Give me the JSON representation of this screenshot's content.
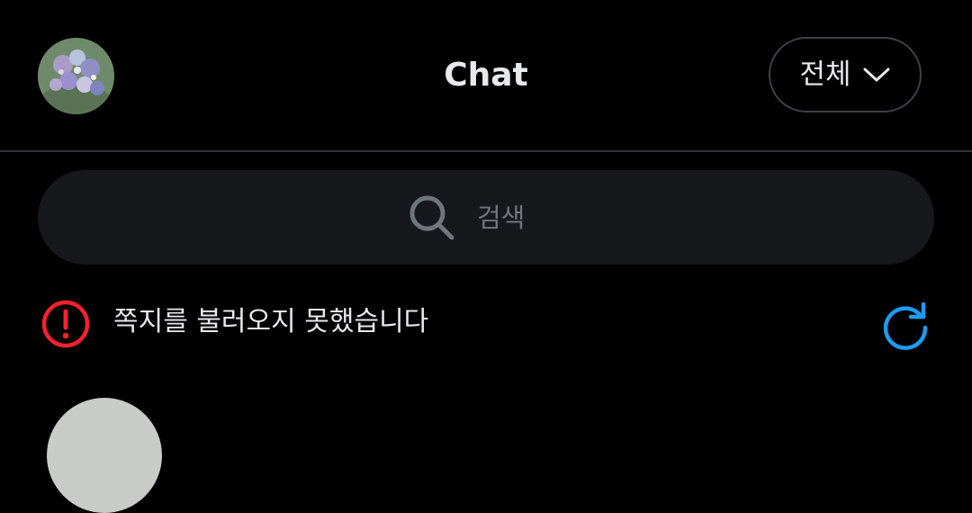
{
  "header": {
    "title": "Chat",
    "avatar_icon": "user-avatar-photo",
    "filter": {
      "label": "전체",
      "icon": "chevron-down-icon"
    }
  },
  "search": {
    "placeholder": "검색",
    "value": "",
    "icon": "search-icon"
  },
  "error": {
    "message": "쪽지를 불러오지 못했습니다",
    "icon": "alert-circle-icon",
    "retry_icon": "refresh-icon"
  },
  "colors": {
    "background": "#000000",
    "text": "#e7e9ea",
    "muted": "#71767b",
    "search_bg": "#16181c",
    "border": "#3e4144",
    "error": "#f4212e",
    "accent": "#1d9bf0"
  }
}
